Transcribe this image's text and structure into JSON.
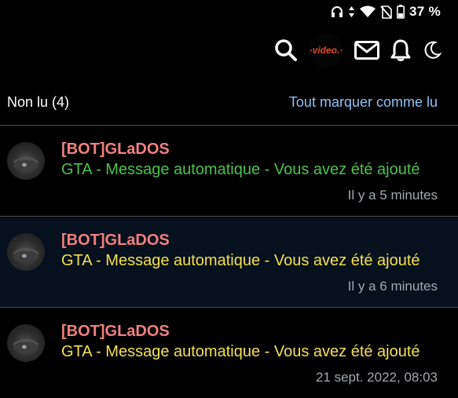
{
  "status_bar": {
    "battery_percent": "37 %",
    "icons": [
      "headphones-icon",
      "data-arrows-icon",
      "wifi-icon",
      "no-sim-icon",
      "battery-icon"
    ]
  },
  "toolbar": {
    "icons": [
      "search-icon",
      "site-logo",
      "mail-icon",
      "bell-icon",
      "moon-icon"
    ],
    "logo_text": "·video.·"
  },
  "header": {
    "title": "Non lu (4)",
    "mark_all_label": "Tout marquer comme lu"
  },
  "notifications": [
    {
      "sender": "[BOT]GLaDOS",
      "subject": "GTA - Message automatique - Vous avez été ajouté",
      "time": "Il y a 5 minutes",
      "subject_color": "#4cc24c"
    },
    {
      "sender": "[BOT]GLaDOS",
      "subject": "GTA - Message automatique - Vous avez été ajouté",
      "time": "Il y a 6 minutes",
      "subject_color": "#f1e050"
    },
    {
      "sender": "[BOT]GLaDOS",
      "subject": "GTA - Message automatique - Vous avez été ajouté",
      "time": "21 sept. 2022, 08:03",
      "subject_color": "#f1e050"
    }
  ],
  "colors": {
    "background": "#000000",
    "highlight_row": "#07101d",
    "sender": "#f08080",
    "link": "#8ec0f0",
    "timestamp": "#a3a8ae"
  }
}
